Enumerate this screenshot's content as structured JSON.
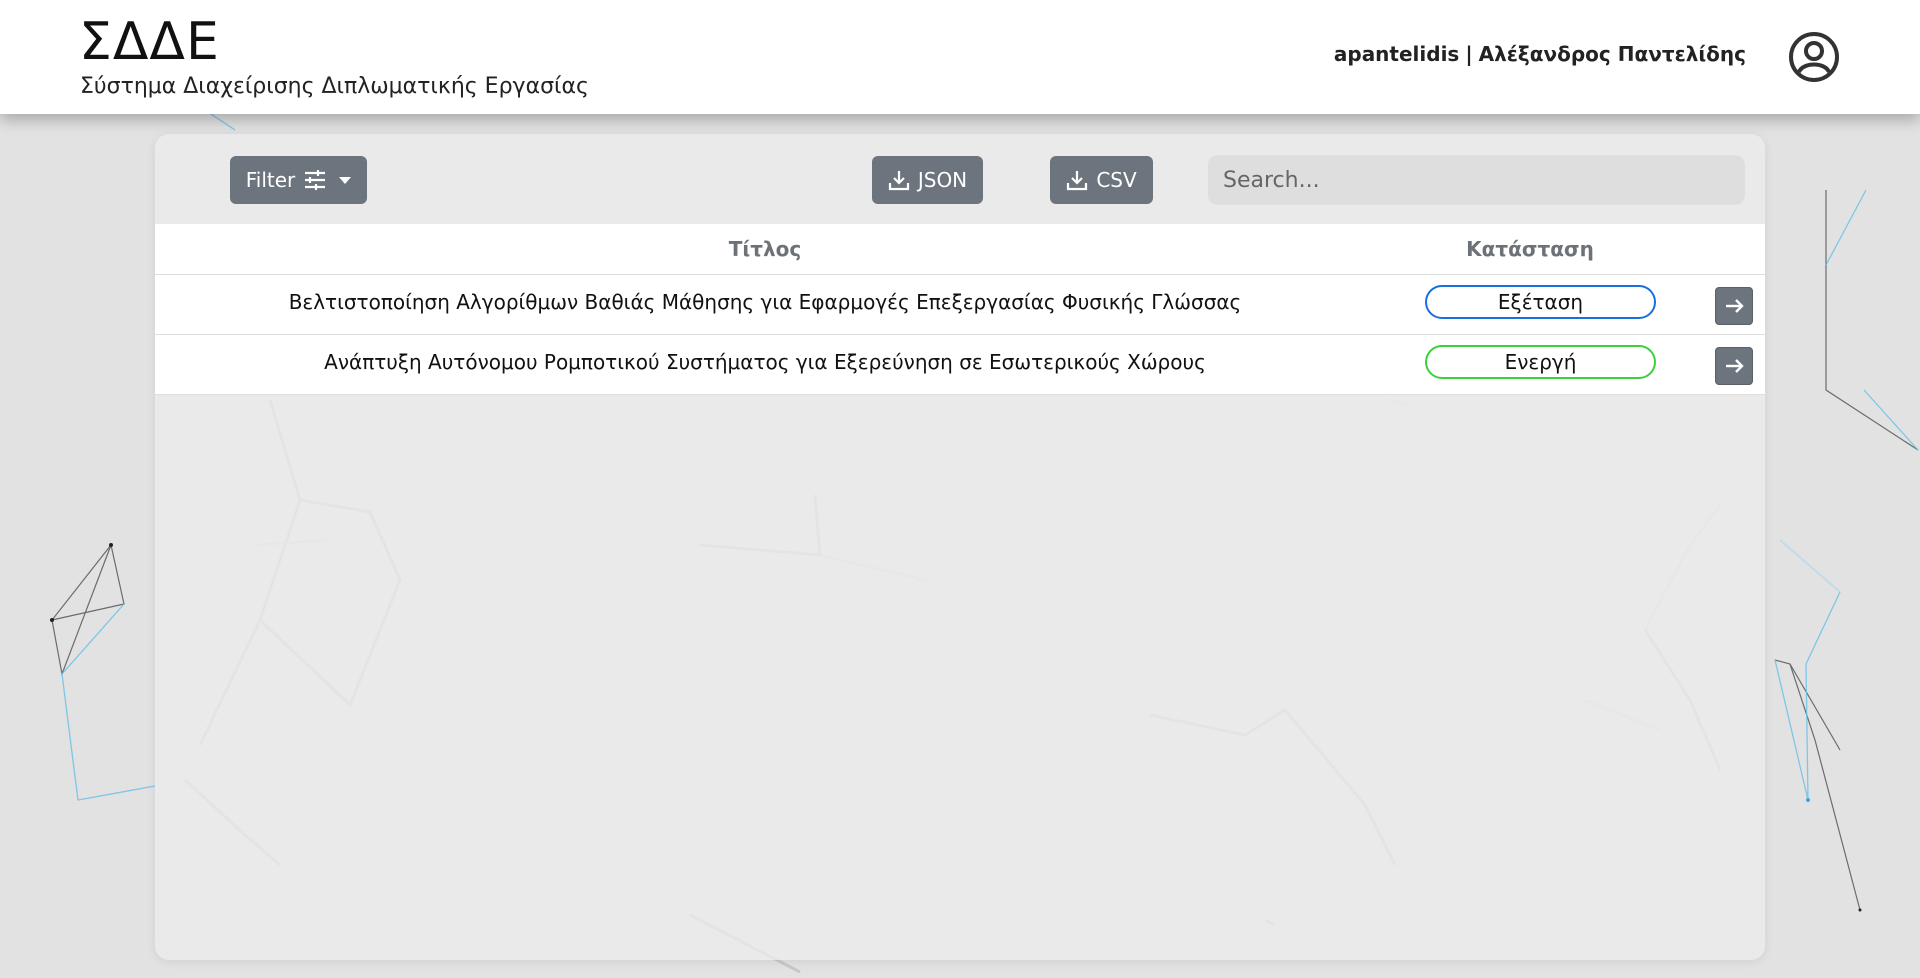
{
  "app": {
    "title": "ΣΔΔΕ",
    "subtitle": "Σύστημα Διαχείρισης Διπλωματικής Εργασίας"
  },
  "user": {
    "username": "apantelidis",
    "separator": "|",
    "full_name": "Αλέξανδρος Παντελίδης",
    "avatar_icon": "user-circle-icon"
  },
  "toolbar": {
    "filter_label": "Filter",
    "filter_icon": "sliders-icon",
    "json_label": "JSON",
    "csv_label": "CSV",
    "download_icon": "download-icon",
    "search_placeholder": "Search..."
  },
  "table": {
    "columns": [
      "Τίτλος",
      "Κατάσταση"
    ],
    "rows": [
      {
        "title": "Βελτιστοποίηση Αλγορίθμων Βαθιάς Μάθησης για Εφαρμογές Επεξεργασίας Φυσικής Γλώσσας",
        "status": "Εξέταση",
        "status_color": "#1a6fe0"
      },
      {
        "title": "Ανάπτυξη Αυτόνομου Ρομποτικού Συστήματος για Εξερεύνηση σε Εσωτερικούς Χώρους",
        "status": "Ενεργή",
        "status_color": "#3ad13a"
      }
    ],
    "row_action_icon": "arrow-right-icon"
  },
  "colors": {
    "button_bg": "#6c757d",
    "header_bg": "#ffffff"
  }
}
